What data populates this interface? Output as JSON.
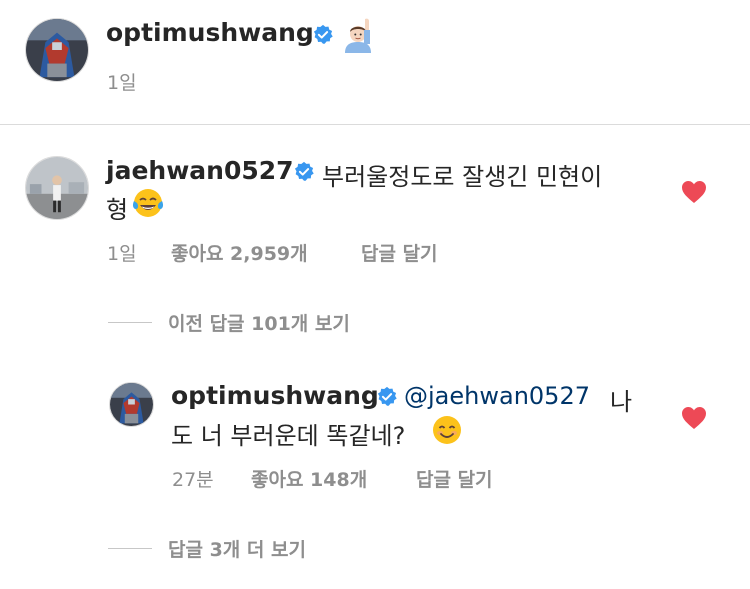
{
  "post": {
    "username": "optimushwang",
    "time": "1일",
    "avatar_icon": "transformer-avatar",
    "verified_icon": "verified-badge-icon",
    "emoji_icon": "raising-hand-emoji"
  },
  "comment": {
    "username": "jaehwan0527",
    "text_line1": "부러울정도로 잘생긴 민현이",
    "text_line2": "형",
    "emoji_icon": "tears-of-joy-emoji",
    "time": "1일",
    "likes": "좋아요 2,959개",
    "reply_label": "답글 달기",
    "liked": true
  },
  "view_previous_replies": "이전 답글 101개 보기",
  "reply": {
    "username": "optimushwang",
    "mention": "@jaehwan0527",
    "text_line1_suffix": "나",
    "text_line2": "도 너 부러운데 똑같네?",
    "emoji_icon": "smiling-emoji",
    "time": "27분",
    "likes": "좋아요 148개",
    "reply_label": "답글 달기",
    "liked": true
  },
  "view_more_replies": "답글 3개 더 보기",
  "colors": {
    "heart": "#ed4956",
    "verified": "#3897f0",
    "mention": "#003569",
    "secondary_text": "#8e8e8e"
  }
}
